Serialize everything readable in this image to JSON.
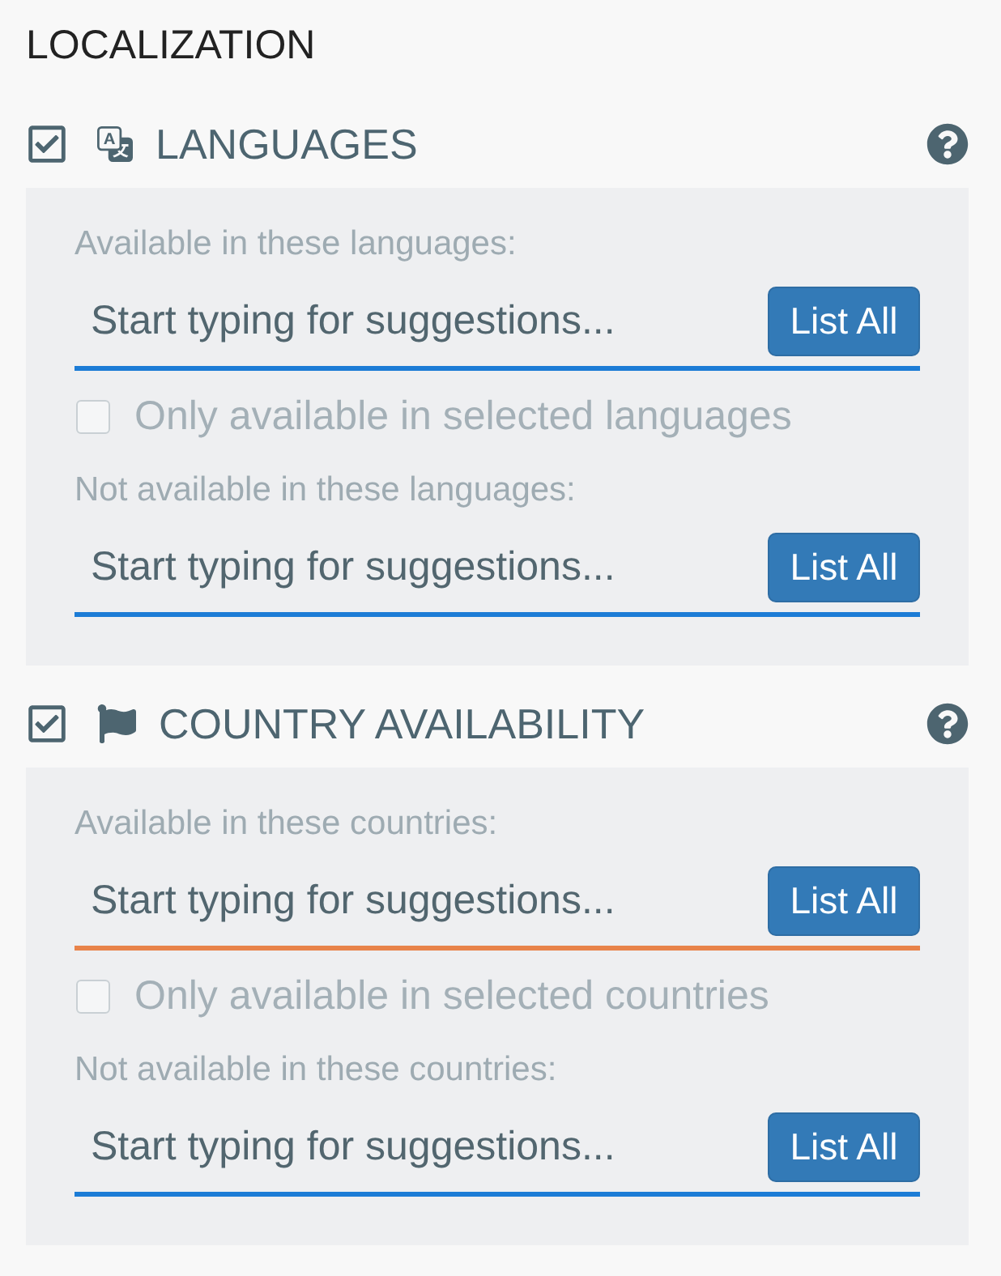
{
  "title": "LOCALIZATION",
  "sections": [
    {
      "kind": "language",
      "title": "LANGUAGES",
      "checked": true,
      "items": [
        {
          "kind": "field",
          "label": "Available in these languages:",
          "placeholder": "Start typing for suggestions...",
          "button": "List All",
          "warning": false
        },
        {
          "kind": "checkbox",
          "label": "Only available in selected languages",
          "checked": false,
          "disabled": true
        },
        {
          "kind": "field",
          "label": "Not available in these languages:",
          "placeholder": "Start typing for suggestions...",
          "button": "List All",
          "warning": false
        }
      ]
    },
    {
      "kind": "country",
      "title": "COUNTRY AVAILABILITY",
      "checked": true,
      "items": [
        {
          "kind": "field",
          "label": "Available in these countries:",
          "placeholder": "Start typing for suggestions...",
          "button": "List All",
          "warning": true
        },
        {
          "kind": "checkbox",
          "label": "Only available in selected countries",
          "checked": false,
          "disabled": true
        },
        {
          "kind": "field",
          "label": "Not available in these countries:",
          "placeholder": "Start typing for suggestions...",
          "button": "List All",
          "warning": false
        }
      ]
    }
  ]
}
